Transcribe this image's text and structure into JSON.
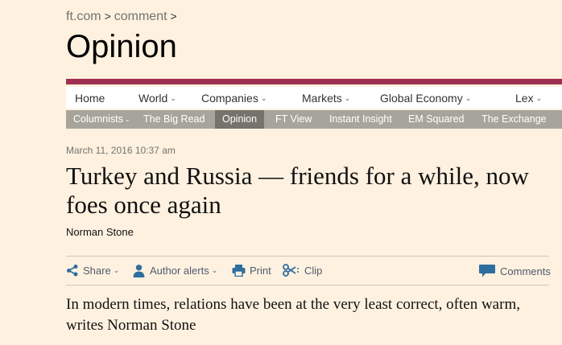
{
  "breadcrumb": {
    "items": [
      "ft.com",
      "comment"
    ],
    "separator": ">"
  },
  "section_title": "Opinion",
  "primary_nav": [
    {
      "label": "Home"
    },
    {
      "label": "World",
      "dropdown": true
    },
    {
      "label": "Companies",
      "dropdown": true
    },
    {
      "label": "Markets",
      "dropdown": true
    },
    {
      "label": "Global Economy",
      "dropdown": true
    },
    {
      "label": "Lex",
      "dropdown": true
    }
  ],
  "secondary_nav": [
    {
      "label": "Columnists",
      "dropdown": true
    },
    {
      "label": "The Big Read"
    },
    {
      "label": "Opinion",
      "active": true
    },
    {
      "label": "FT View"
    },
    {
      "label": "Instant Insight"
    },
    {
      "label": "EM Squared"
    },
    {
      "label": "The Exchange"
    }
  ],
  "article": {
    "date": "March 11, 2016 10:37 am",
    "headline": "Turkey and Russia — friends for a while, now foes once again",
    "author": "Norman Stone",
    "standfirst": "In modern times, relations have been at the very least correct, often warm, writes Norman Stone"
  },
  "tools": {
    "share": "Share",
    "author_alerts": "Author alerts",
    "print": "Print",
    "clip": "Clip",
    "comments": "Comments"
  },
  "icons": {
    "share": "share-icon",
    "author_alerts": "person-icon",
    "print": "printer-icon",
    "clip": "scissors-icon",
    "comments": "speech-bubble-icon"
  },
  "colors": {
    "background": "#fff1e0",
    "accent_bar": "#9e2f50",
    "subnav_bg": "#a7a59b",
    "subnav_active": "#74736c",
    "tool_text": "#4e5a6e",
    "tool_icon": "#2e6e9e"
  }
}
